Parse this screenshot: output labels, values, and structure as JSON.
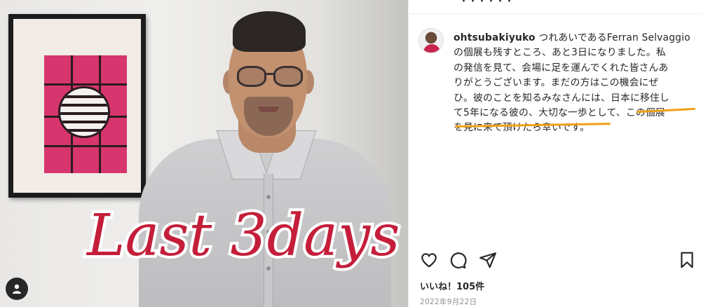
{
  "photo": {
    "overlay_text": "Last 3days",
    "overlay_color": "#c41e3a",
    "overlay_stroke": "#ffffff"
  },
  "header": {
    "partial_title": "・・・・・・"
  },
  "post": {
    "username": "ohtsubakiyuko",
    "caption_lines": [
      " つれあいであるFerran Selvaggio",
      "の個展も残すところ、あと3日になりました。私",
      "の発信を見て、会場に足を運んでくれた皆さんあ",
      "りがとうございます。まだの方はこの機会にぜ",
      "ひ。彼のことを知るみなさんには、日本に移住し",
      "て5年になる彼の、大切な一歩として、この個展",
      "を見に来て頂けたら幸いです。"
    ],
    "highlight_color": "#f0a116",
    "likes": "いいね！105件",
    "date": "2022年9月22日"
  },
  "actions": {
    "icons": [
      "heart-icon",
      "comment-icon",
      "share-icon",
      "bookmark-icon"
    ]
  }
}
